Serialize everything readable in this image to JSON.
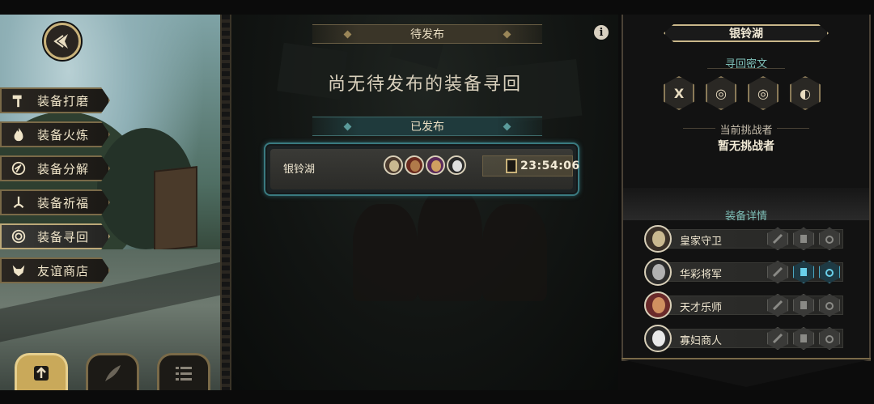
{
  "menu": {
    "items": [
      {
        "label": "装备打磨",
        "icon": "hammer-icon"
      },
      {
        "label": "装备火炼",
        "icon": "flame-icon"
      },
      {
        "label": "装备分解",
        "icon": "disassemble-icon"
      },
      {
        "label": "装备祈福",
        "icon": "blessing-icon"
      },
      {
        "label": "装备寻回",
        "icon": "spiral-icon",
        "active": true
      },
      {
        "label": "友谊商店",
        "icon": "fox-icon"
      }
    ]
  },
  "bottom_nav": [
    {
      "icon": "upload-arrow-icon",
      "active": true
    },
    {
      "icon": "feather-icon",
      "active": false
    },
    {
      "icon": "list-icon",
      "active": false
    }
  ],
  "center": {
    "pending_title": "待发布",
    "pending_empty": "尚无待发布的装备寻回",
    "published_title": "已发布",
    "info_glyph": "i",
    "published_card": {
      "name": "银铃湖",
      "timer": "23:54:06"
    }
  },
  "right_panel": {
    "title": "银铃湖",
    "runes_title": "寻回密文",
    "runes": [
      "X",
      "◎",
      "◎",
      "◐"
    ],
    "challenger_label": "当前挑战者",
    "challenger_value": "暂无挑战者",
    "details_title": "装备详情",
    "heroes": [
      {
        "name": "皇家守卫",
        "lit_slots": [
          false,
          false,
          false
        ]
      },
      {
        "name": "华彩将军",
        "lit_slots": [
          false,
          true,
          true
        ]
      },
      {
        "name": "天才乐师",
        "lit_slots": [
          false,
          false,
          false
        ]
      },
      {
        "name": "寡妇商人",
        "lit_slots": [
          false,
          false,
          false
        ]
      }
    ]
  },
  "colors": {
    "gold": "#c9b27a",
    "teal": "#7fc0b8",
    "card_glow": "#3a7a80"
  }
}
